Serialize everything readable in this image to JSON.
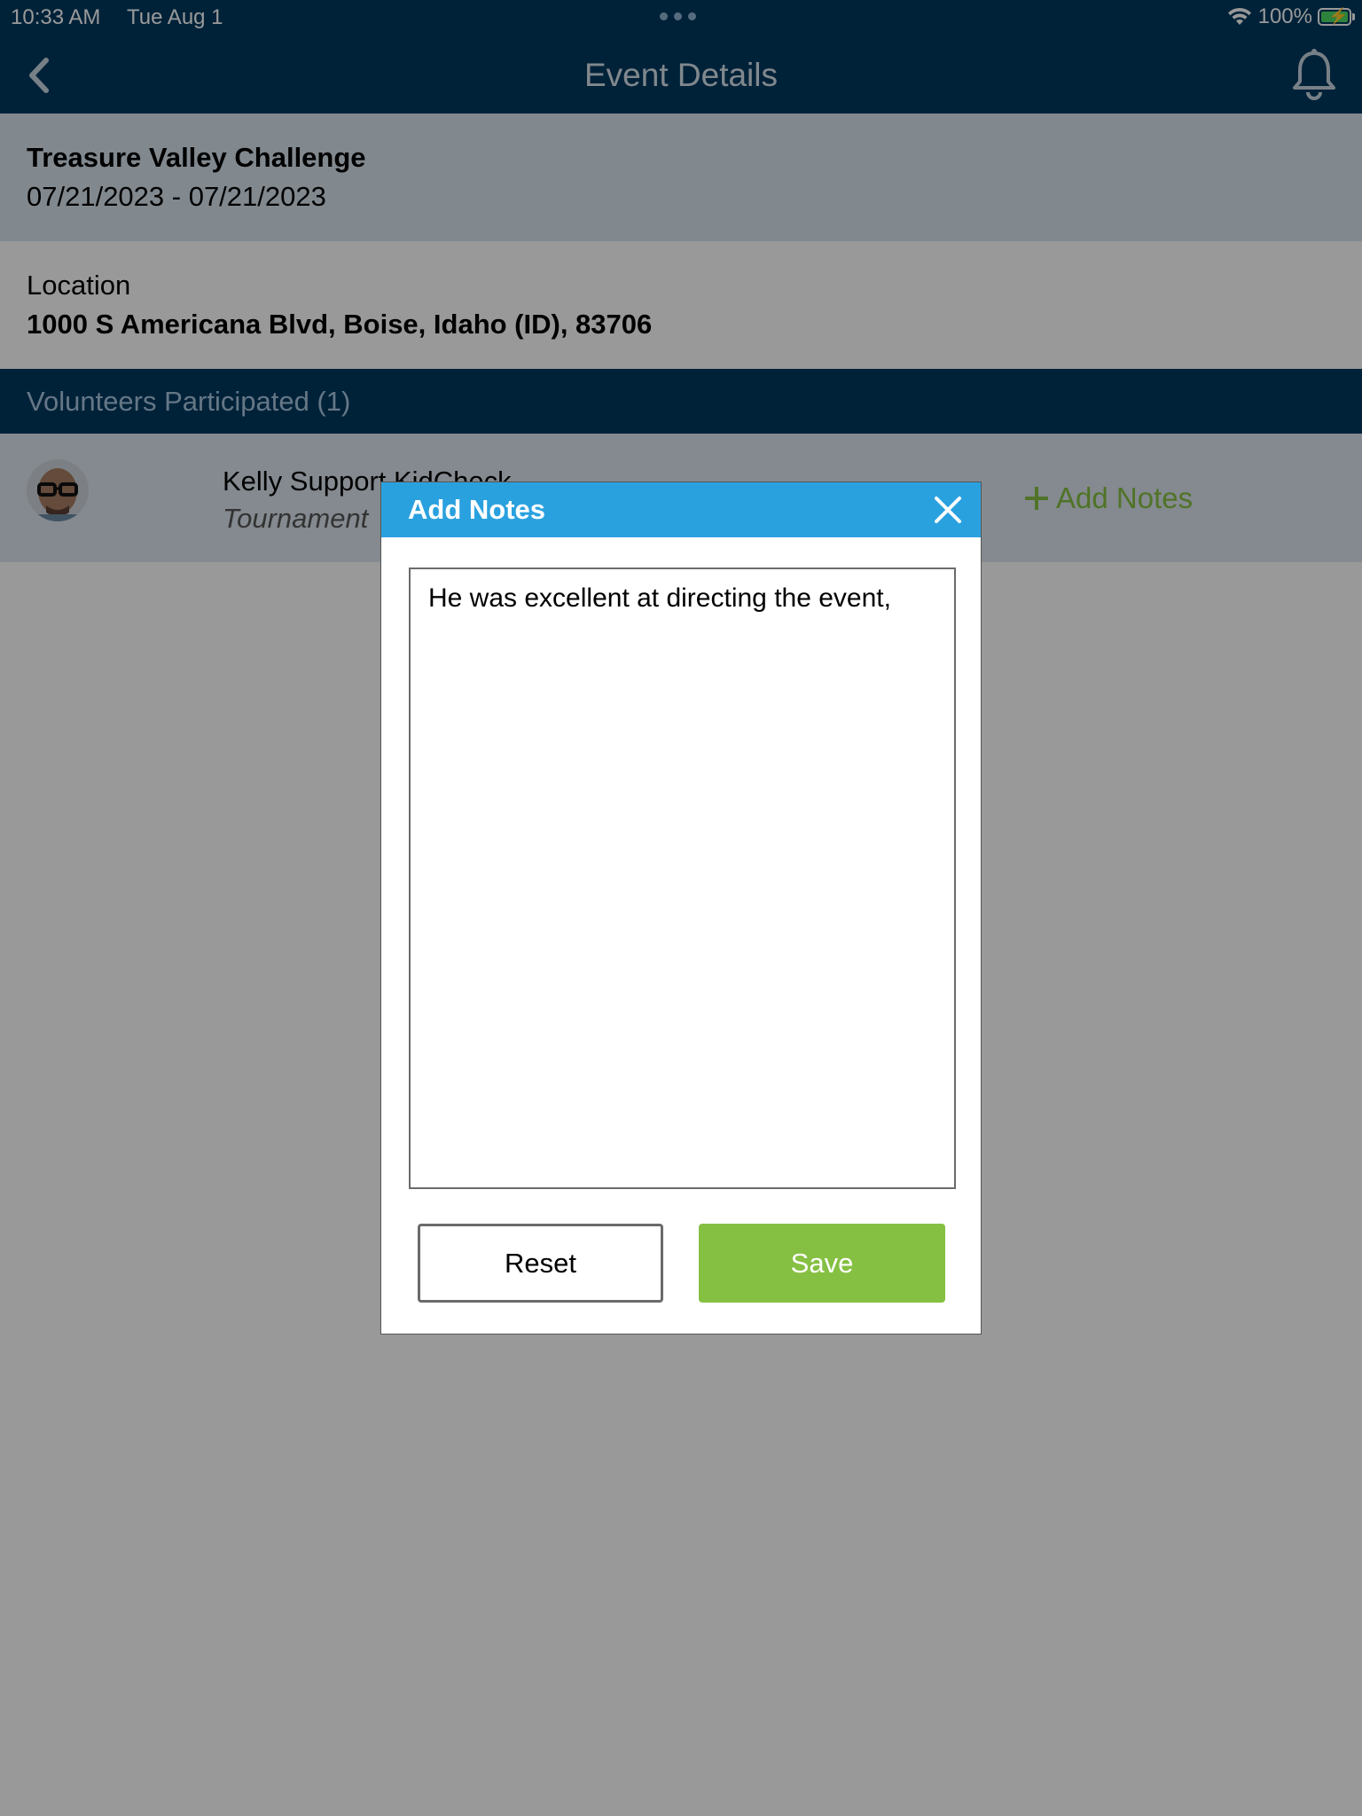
{
  "status_bar": {
    "time": "10:33 AM",
    "date": "Tue Aug 1",
    "battery_percent": "100%"
  },
  "nav": {
    "title": "Event Details"
  },
  "event": {
    "name": "Treasure Valley Challenge",
    "dates": "07/21/2023 - 07/21/2023"
  },
  "location": {
    "label": "Location",
    "address": "1000 S Americana Blvd, Boise, Idaho (ID), 83706"
  },
  "volunteers": {
    "header": "Volunteers Participated (1)",
    "items": [
      {
        "name": "Kelly Support KidCheck",
        "role": "Tournament",
        "add_notes_label": "Add Notes"
      }
    ]
  },
  "modal": {
    "title": "Add Notes",
    "notes_value": "He was excellent at directing the event,",
    "reset_label": "Reset",
    "save_label": "Save"
  },
  "colors": {
    "nav_bg": "#003a60",
    "modal_header": "#2aa1df",
    "accent_green": "#86c043"
  }
}
